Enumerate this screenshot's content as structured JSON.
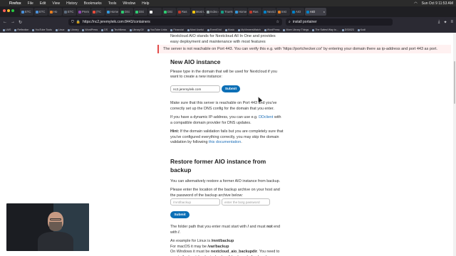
{
  "menubar": {
    "app": "Firefox",
    "items": [
      "File",
      "Edit",
      "View",
      "History",
      "Bookmarks",
      "Tools",
      "Window",
      "Help"
    ],
    "clock": "Sun Oct 9  11:53 AM"
  },
  "tabs": [
    {
      "label": "ETC",
      "color": "#4a90d9"
    },
    {
      "label": "ETC",
      "color": "#4a90d9"
    },
    {
      "label": "Ho",
      "color": "#e67e22"
    },
    {
      "label": "ETC",
      "color": "#5d6d7e"
    },
    {
      "label": "Prem",
      "color": "#8e44ad"
    },
    {
      "label": "(TC",
      "color": "#e74c3c"
    },
    {
      "label": "Home",
      "color": "#3498db"
    },
    {
      "label": "DSi",
      "color": "#2ecc71"
    },
    {
      "label": "DSi",
      "color": "#2ecc71"
    },
    {
      "label": "",
      "color": "#ffffff"
    },
    {
      "label": "DSi",
      "color": "#2ecc71"
    },
    {
      "label": "Ras",
      "color": "#c0392b"
    },
    {
      "label": "Most Useful",
      "color": "#f1c40f"
    },
    {
      "label": "Index of /",
      "color": "#95a5a6"
    },
    {
      "label": "TrueN",
      "color": "#16a085"
    },
    {
      "label": "Home",
      "color": "#3498db"
    },
    {
      "label": "Ras",
      "color": "#c0392b"
    },
    {
      "label": "Nextcl",
      "color": "#0082c9"
    },
    {
      "label": "Inst",
      "color": "#e67e22"
    },
    {
      "label": "AIO",
      "color": "#0082c9"
    },
    {
      "label": "AIO",
      "color": "#0082c9",
      "active": true
    }
  ],
  "toolbar": {
    "url": "https://nc2.jeremyleik.com:8443/containers",
    "search": "install portainer"
  },
  "bookmarks": [
    "LMS",
    "Reflection",
    "YouTube Tools",
    "Linux",
    "Library",
    "WordPress",
    "DS",
    "TechNews",
    "Library/JV",
    "YouTube Links",
    "Financial",
    "Most Useful",
    "EventGrid",
    "Music",
    "MyViewersWatch",
    "WordPress",
    "More Library Things",
    "The Safest Way to...",
    "DS0023",
    "Kodi"
  ],
  "page": {
    "intro": "Nextcloud AIO stands for Nextcloud All In One and provides easy deployment and maintenance with most features",
    "warning": "The server is not reachable on Port 443. You can verify this e.g. with 'https://portchecker.co/' by entering your domain there as ip-address and port 443 as port.",
    "new_heading": "New AIO instance",
    "new_desc": "Please type in the domain that will be used for Nextcloud if you want to create a new instance:",
    "domain_value": "nc2.jeremyleik.com",
    "submit_label": "Submit",
    "p1": "Make sure that this server is reachable on Port 443 and you've correctly set up the DNS config for the domain that you enter.",
    "p2_before": "If you have a dynamic IP-address, you can use e.g. ",
    "p2_link": "DDclient",
    "p2_after": " with a compatible domain provider for DNS updates.",
    "hint_label": "Hint:",
    "hint_text": " If the domain validation fails but you are completely sure that you've configured everything correctly, you may skip the domain validation by following ",
    "hint_link": "this documentation",
    "hint_end": ".",
    "restore_heading": "Restore former AIO instance from backup",
    "restore_desc": "You can alternatively restore a former AIO instance from backup.",
    "restore_desc2": "Please enter the location of the backup archive on your host and the password of the backup archive below:",
    "backup_path_placeholder": "/mnt/backup",
    "backup_password_placeholder": "enter the borg password",
    "restore_submit": "Submit",
    "folder_note_a": "The folder path that you enter must start with ",
    "folder_note_b": "/",
    "folder_note_c": " and must ",
    "folder_note_d": "not",
    "folder_note_e": " end with ",
    "folder_note_f": "/",
    "folder_note_g": ".",
    "ex_linux_a": "An example for Linux is ",
    "ex_linux_b": "/mnt/backup",
    "ex_mac_a": "For macOS it may be ",
    "ex_mac_b": "/var/backup",
    "ex_win_a": "On Windows it must be ",
    "ex_win_b": "nextcloud_aio_backupdir",
    "ex_win_c": ". You need to create the 'nextcloud_aio_backupdir' volume beforehand"
  }
}
